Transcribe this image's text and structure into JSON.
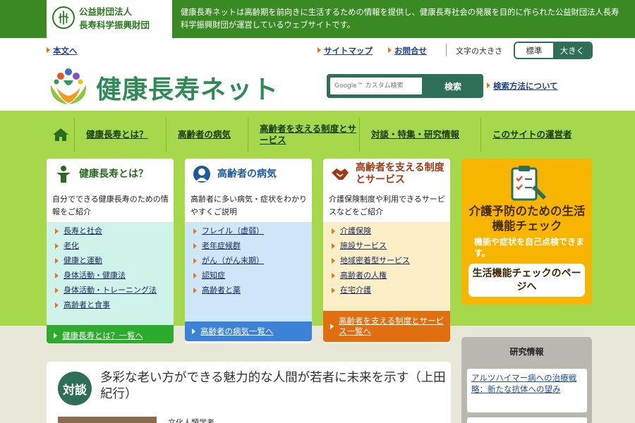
{
  "header": {
    "org_name_line1": "公益財団法人",
    "org_name_line2": "長寿科学振興財団",
    "site_description": "健康長寿ネットは高齢期を前向きに生活するための情報を提供し、健康長寿社会の発展を目的に作られた公益財団法人長寿科学振興財団が運営しているウェブサイトです。"
  },
  "util": {
    "skip_link": "本文へ",
    "sitemap": "サイトマップ",
    "contact": "お問合せ",
    "font_size_label": "文字の大きさ",
    "font_standard": "標準",
    "font_large": "大きく"
  },
  "logo": {
    "text": "健康長寿ネット"
  },
  "search": {
    "placeholder": "Google™ カスタム検索",
    "button": "検索",
    "help_link": "検索方法について"
  },
  "nav": {
    "items": [
      {
        "label": "健康長寿とは？"
      },
      {
        "label": "高齢者の病気"
      },
      {
        "label": "高齢者を支える制度とサービス"
      },
      {
        "label": "対談・特集・研究情報"
      },
      {
        "label": "このサイトの運営者"
      }
    ]
  },
  "cards": [
    {
      "title": "健康長寿とは？",
      "desc": "自分でできる健康長寿のための情報をご紹介",
      "links": [
        "長寿と社会",
        "老化",
        "健康と運動",
        "身体活動・健康法",
        "身体活動・トレーニング法",
        "高齢者と食事"
      ],
      "footer": "健康長寿とは？一覧へ"
    },
    {
      "title": "高齢者の病気",
      "desc": "高齢者に多い病気・症状をわかりやすくご説明",
      "links": [
        "フレイル（虚弱）",
        "老年症候群",
        "がん（がん末期）",
        "認知症",
        "高齢者と薬"
      ],
      "footer": "高齢者の病気一覧へ"
    },
    {
      "title": "高齢者を支える制度とサービス",
      "desc": "介護保険制度や利用できるサービスなどをご紹介",
      "links": [
        "介護保険",
        "施設サービス",
        "地域密着型サービス",
        "高齢者の人権",
        "在宅介護"
      ],
      "footer": "高齢者を支える制度とサービス一覧へ"
    }
  ],
  "check": {
    "title": "介護予防のための生活機能チェック",
    "desc": "機能や症状を自己点検できます。",
    "button": "生活機能チェックのページへ"
  },
  "talk": {
    "badge": "対談",
    "title": "多彩な老い方ができる魅力的な人間が若者に未来を示す（上田 紀行）",
    "role": "文化人類学者"
  },
  "research": {
    "title": "研究情報",
    "item": "アルツハイマー病への治療戦略：新たな抗体への望み"
  },
  "colors": {
    "header_green": "#3a8a24",
    "nav_lime": "#a5d84b",
    "accent_teal": "#2e6f58",
    "check_yellow": "#f7b500"
  }
}
